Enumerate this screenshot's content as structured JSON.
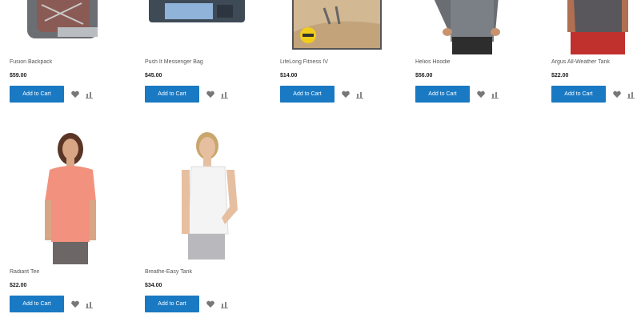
{
  "products": [
    {
      "name": "Fusion Backpack",
      "price": "$59.00",
      "button": "Add to Cart",
      "image": "backpack-image"
    },
    {
      "name": "Push It Messenger Bag",
      "price": "$45.00",
      "button": "Add to Cart",
      "image": "messenger-bag-image"
    },
    {
      "name": "LifeLong Fitness IV",
      "price": "$14.00",
      "button": "Add to Cart",
      "image": "dvd-image"
    },
    {
      "name": "Helios Hoodie",
      "price": "$56.00",
      "button": "Add to Cart",
      "image": "hoodie-image"
    },
    {
      "name": "Argus All-Weather Tank",
      "price": "$22.00",
      "button": "Add to Cart",
      "image": "tank-image"
    },
    {
      "name": "Radiant Tee",
      "price": "$22.00",
      "button": "Add to Cart",
      "image": "tee-image"
    },
    {
      "name": "Breathe-Easy Tank",
      "price": "$34.00",
      "button": "Add to Cart",
      "image": "white-tank-image"
    }
  ],
  "icons": {
    "wishlist": "heart-icon",
    "compare": "compare-icon"
  },
  "colors": {
    "button": "#1979c3"
  }
}
